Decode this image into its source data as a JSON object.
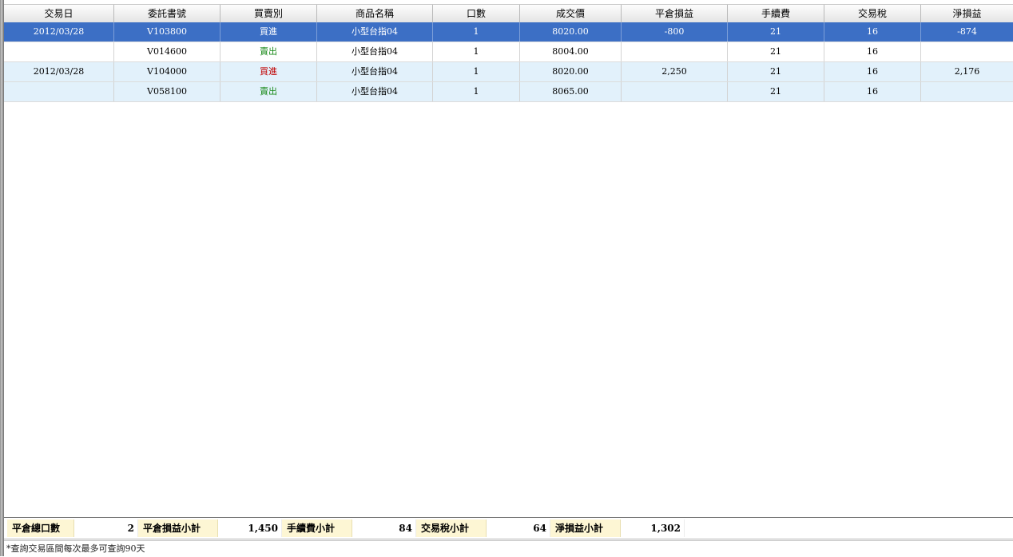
{
  "columns": [
    "交易日",
    "委託書號",
    "買賣別",
    "商品名稱",
    "口數",
    "成交價",
    "平倉損益",
    "手續費",
    "交易稅",
    "淨損益"
  ],
  "rows": [
    {
      "date": "2012/03/28",
      "order_no": "V103800",
      "side": "買進",
      "side_type": "buy",
      "product": "小型台指04",
      "qty": "1",
      "price": "8020.00",
      "close_pl": "-800",
      "fee": "21",
      "tax": "16",
      "net_pl": "-874",
      "style": "selected"
    },
    {
      "date": "",
      "order_no": "V014600",
      "side": "賣出",
      "side_type": "sell",
      "product": "小型台指04",
      "qty": "1",
      "price": "8004.00",
      "close_pl": "",
      "fee": "21",
      "tax": "16",
      "net_pl": "",
      "style": "plain"
    },
    {
      "date": "2012/03/28",
      "order_no": "V104000",
      "side": "買進",
      "side_type": "buy",
      "product": "小型台指04",
      "qty": "1",
      "price": "8020.00",
      "close_pl": "2,250",
      "fee": "21",
      "tax": "16",
      "net_pl": "2,176",
      "style": "alt"
    },
    {
      "date": "",
      "order_no": "V058100",
      "side": "賣出",
      "side_type": "sell",
      "product": "小型台指04",
      "qty": "1",
      "price": "8065.00",
      "close_pl": "",
      "fee": "21",
      "tax": "16",
      "net_pl": "",
      "style": "alt"
    }
  ],
  "summary": {
    "total_qty_label": "平倉總口數",
    "total_qty": "2",
    "close_pl_label": "平倉損益小計",
    "close_pl": "1,450",
    "fee_label": "手續費小計",
    "fee": "84",
    "tax_label": "交易稅小計",
    "tax": "64",
    "net_pl_label": "淨損益小計",
    "net_pl": "1,302"
  },
  "status": {
    "message": "*查詢交易區間每次最多可查詢90天"
  },
  "colors": {
    "selected_row": "#3c6fc5",
    "alt_row": "#e2f1fb",
    "buy": "#c00000",
    "sell": "#1a8a1a",
    "summary_label_bg": "#fdf6d4"
  }
}
